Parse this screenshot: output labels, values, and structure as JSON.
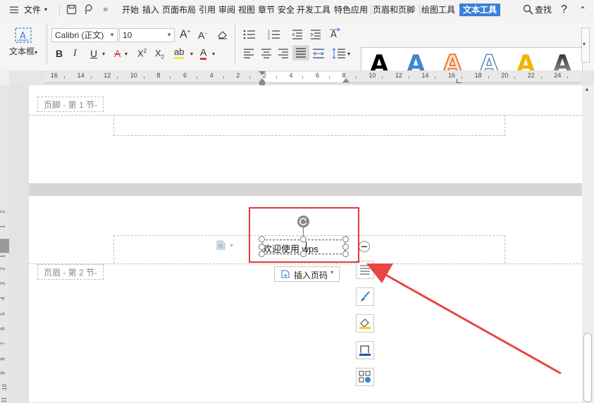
{
  "menu": {
    "file_label": "文件",
    "tabs": [
      "开始",
      "插入",
      "页面布局",
      "引用",
      "审阅",
      "视图",
      "章节",
      "安全",
      "开发工具",
      "特色应用",
      "页眉和页脚",
      "绘图工具",
      "文本工具"
    ],
    "search_label": "查找",
    "help_label": "?"
  },
  "ribbon": {
    "textbox_label": "文本框",
    "font_name": "Calibri (正文)",
    "font_size": "10",
    "art_letters": [
      "A",
      "A",
      "A",
      "A",
      "A",
      "A"
    ]
  },
  "ruler": {
    "numbers": [
      "16",
      "14",
      "12",
      "10",
      "8",
      "6",
      "4",
      "2",
      "2",
      "4",
      "6",
      "8",
      "10",
      "12",
      "14",
      "16",
      "18",
      "20",
      "22",
      "24"
    ]
  },
  "vruler": {
    "numbers": [
      "2",
      "1",
      "1",
      "2",
      "3",
      "4",
      "5",
      "6",
      "7",
      "8",
      "9",
      "10",
      "11"
    ]
  },
  "page1": {
    "footer_tag": "页脚 - 第 1 节-"
  },
  "page2": {
    "header_tag": "页眉 - 第 2 节-",
    "textbox_text": "欢迎使用 wps",
    "insert_page_number_label": "插入页码"
  },
  "colors": {
    "accent_tab": "#3b7fd6",
    "highlight_box": "#e03a3a",
    "arrow": "#e84545"
  }
}
